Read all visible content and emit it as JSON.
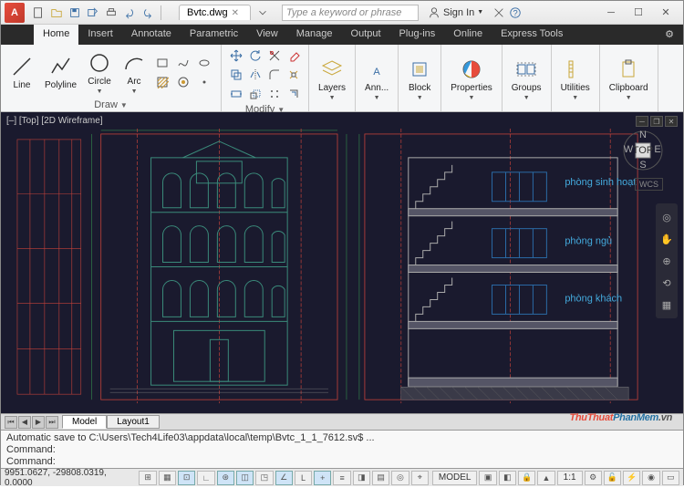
{
  "title_tab": "Bvtc.dwg",
  "search_placeholder": "Type a keyword or phrase",
  "signin": "Sign In",
  "ribbon_tabs": [
    "Home",
    "Insert",
    "Annotate",
    "Parametric",
    "View",
    "Manage",
    "Output",
    "Plug-ins",
    "Online",
    "Express Tools"
  ],
  "draw_panel": {
    "title": "Draw",
    "btns": [
      "Line",
      "Polyline",
      "Circle",
      "Arc"
    ]
  },
  "modify_panel": {
    "title": "Modify"
  },
  "panels_right": [
    "Layers",
    "Ann...",
    "Block",
    "Properties",
    "Groups",
    "Utilities",
    "Clipboard"
  ],
  "view_label": "[–] [Top] [2D Wireframe]",
  "wcs": "WCS",
  "viewcube_face": "TOP",
  "layout_tabs": [
    "Model",
    "Layout1"
  ],
  "cmd_lines": [
    "Automatic save to C:\\Users\\Tech4Life03\\appdata\\local\\temp\\Bvtc_1_1_7612.sv$ ...",
    "Command:",
    "Command:"
  ],
  "coords": "9951.0627, -29808.0319, 0.0000",
  "model_btn": "MODEL",
  "scale": "1:1",
  "watermark": {
    "a": "ThuThuat",
    "b": "PhanMem",
    "c": ".vn"
  }
}
